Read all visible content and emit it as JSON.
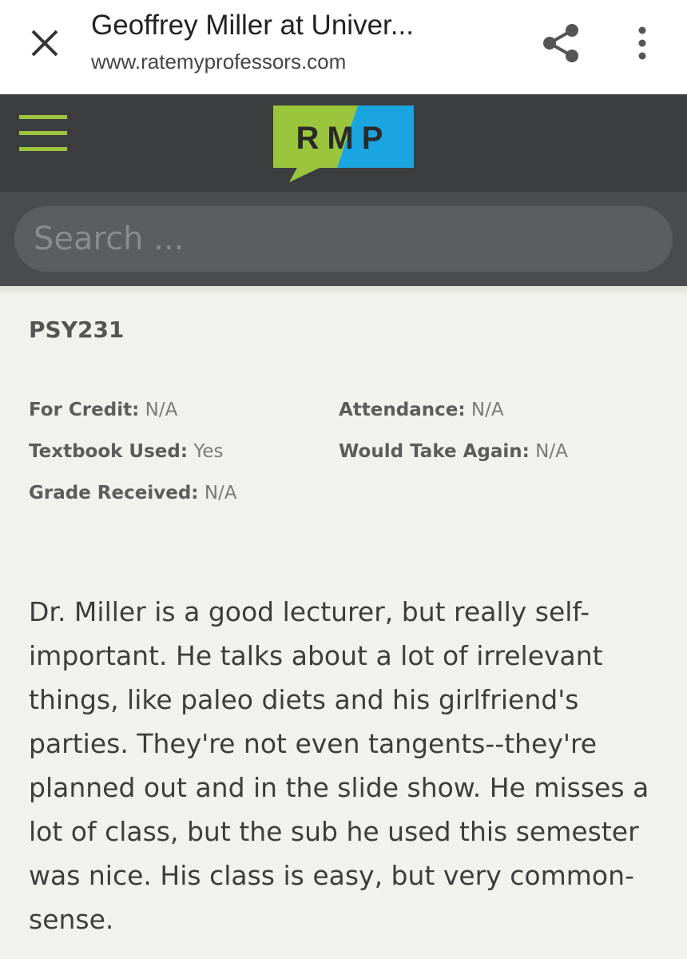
{
  "browser": {
    "title": "Geoffrey Miller at Univer...",
    "url": "www.ratemyprofessors.com",
    "icons": {
      "close": "close-icon",
      "share": "share-icon",
      "more": "more-vertical-icon"
    }
  },
  "header": {
    "menu_icon": "hamburger-icon",
    "logo_text": "RMP",
    "colors": {
      "background": "#3b3d3e",
      "logo_green": "#9bc53d",
      "logo_blue": "#1ba5e0",
      "menu": "#9bc53d"
    }
  },
  "search": {
    "placeholder": "Search ..."
  },
  "rating": {
    "course": "PSY231",
    "for_credit": {
      "label": "For Credit:",
      "value": "N/A"
    },
    "attendance": {
      "label": "Attendance:",
      "value": "N/A"
    },
    "textbook_used": {
      "label": "Textbook Used:",
      "value": "Yes"
    },
    "would_take_again": {
      "label": "Would Take Again:",
      "value": "N/A"
    },
    "grade_received": {
      "label": "Grade Received:",
      "value": "N/A"
    },
    "comment": "Dr. Miller is a good lecturer, but really self-important. He talks about a lot of irrelevant things, like paleo diets and his girlfriend's parties. They're not even tangents--they're planned out and in the slide show. He misses a lot of class, but the sub he used this semester was nice. His class is easy, but very common-sense."
  }
}
